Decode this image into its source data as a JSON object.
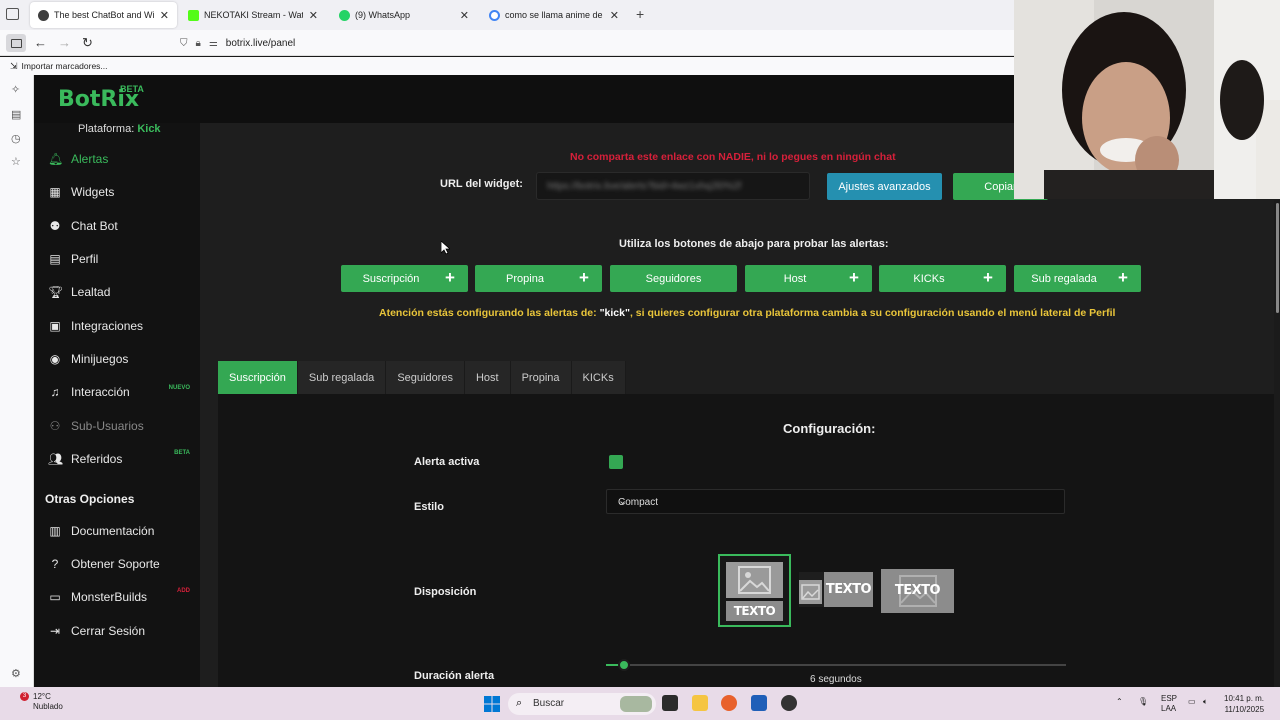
{
  "browser": {
    "tabs": [
      {
        "title": "The best ChatBot and Widgets f",
        "favicon_color": "#3d3d3d",
        "active": true
      },
      {
        "title": "NEKOTAKI Stream - Watch Live",
        "favicon_color": "#53fc18",
        "active": false
      },
      {
        "title": "(9) WhatsApp",
        "favicon_color": "#25d366",
        "active": false
      },
      {
        "title": "como se llama anime de banda",
        "favicon_color": "#4285f4",
        "active": false
      }
    ],
    "new_tab": "+",
    "url": "botrix.live/panel",
    "bookmark": "Importar marcadores..."
  },
  "brand": {
    "name": "BotRix",
    "beta": "BETA",
    "accent": "#3aba5c"
  },
  "platform": {
    "label": "Plataforma:",
    "value": "Kick"
  },
  "nav": {
    "items": [
      {
        "label": "Alertas",
        "icon": "bell-icon"
      },
      {
        "label": "Widgets",
        "icon": "grid-icon"
      },
      {
        "label": "Chat Bot",
        "icon": "robot-icon"
      },
      {
        "label": "Perfil",
        "icon": "id-card-icon"
      },
      {
        "label": "Lealtad",
        "icon": "trophy-icon"
      },
      {
        "label": "Integraciones",
        "icon": "puzzle-icon"
      },
      {
        "label": "Minijuegos",
        "icon": "gamepad-icon"
      },
      {
        "label": "Interacción",
        "icon": "music-icon",
        "badge": "NUEVO"
      },
      {
        "label": "Sub-Usuarios",
        "icon": "users-icon"
      },
      {
        "label": "Referidos",
        "icon": "user-friends-icon",
        "badge": "BETA"
      }
    ],
    "other_title": "Otras Opciones",
    "other": [
      {
        "label": "Documentación",
        "icon": "book-icon"
      },
      {
        "label": "Obtener Soporte",
        "icon": "question-icon"
      },
      {
        "label": "MonsterBuilds",
        "icon": "laptop-icon",
        "badge": "ADD"
      },
      {
        "label": "Cerrar Sesión",
        "icon": "logout-icon"
      }
    ]
  },
  "widget": {
    "warning": "No comparta este enlace con NADIE, ni lo pegues en ningún chat",
    "url_label": "URL del widget:",
    "url_value": "https://botrix.live/alerts?bid=4wz1xhq2l0%2f",
    "advanced_button": "Ajustes avanzados",
    "copy_button": "Copiar"
  },
  "test": {
    "title": "Utiliza los botones de abajo para probar las alertas:",
    "buttons": [
      "Suscripción",
      "Propina",
      "Seguidores",
      "Host",
      "KICKs",
      "Sub regalada"
    ],
    "attention_prefix": "Atención estás configurando las alertas de: ",
    "attention_platform": "\"kick\"",
    "attention_suffix": ", si quieres configurar otra plataforma cambia a su configuración usando el menú lateral de Perfil"
  },
  "tabs": [
    "Suscripción",
    "Sub regalada",
    "Seguidores",
    "Host",
    "Propina",
    "KICKs"
  ],
  "config": {
    "title": "Configuración:",
    "active_label": "Alerta activa",
    "active_checked": true,
    "style_label": "Estilo",
    "style_value": "Compact",
    "layout_label": "Disposición",
    "layout_text": "TEXTO",
    "duration_label": "Duración alerta",
    "duration_value": "6 segundos",
    "duration_seconds": 6
  },
  "taskbar": {
    "weather_temp": "12°C",
    "weather_desc": "Nublado",
    "weather_badge": "3",
    "search": "Buscar",
    "lang1": "ESP",
    "lang2": "LAA",
    "time": "10:41 p. m.",
    "date": "11/10/2025"
  }
}
